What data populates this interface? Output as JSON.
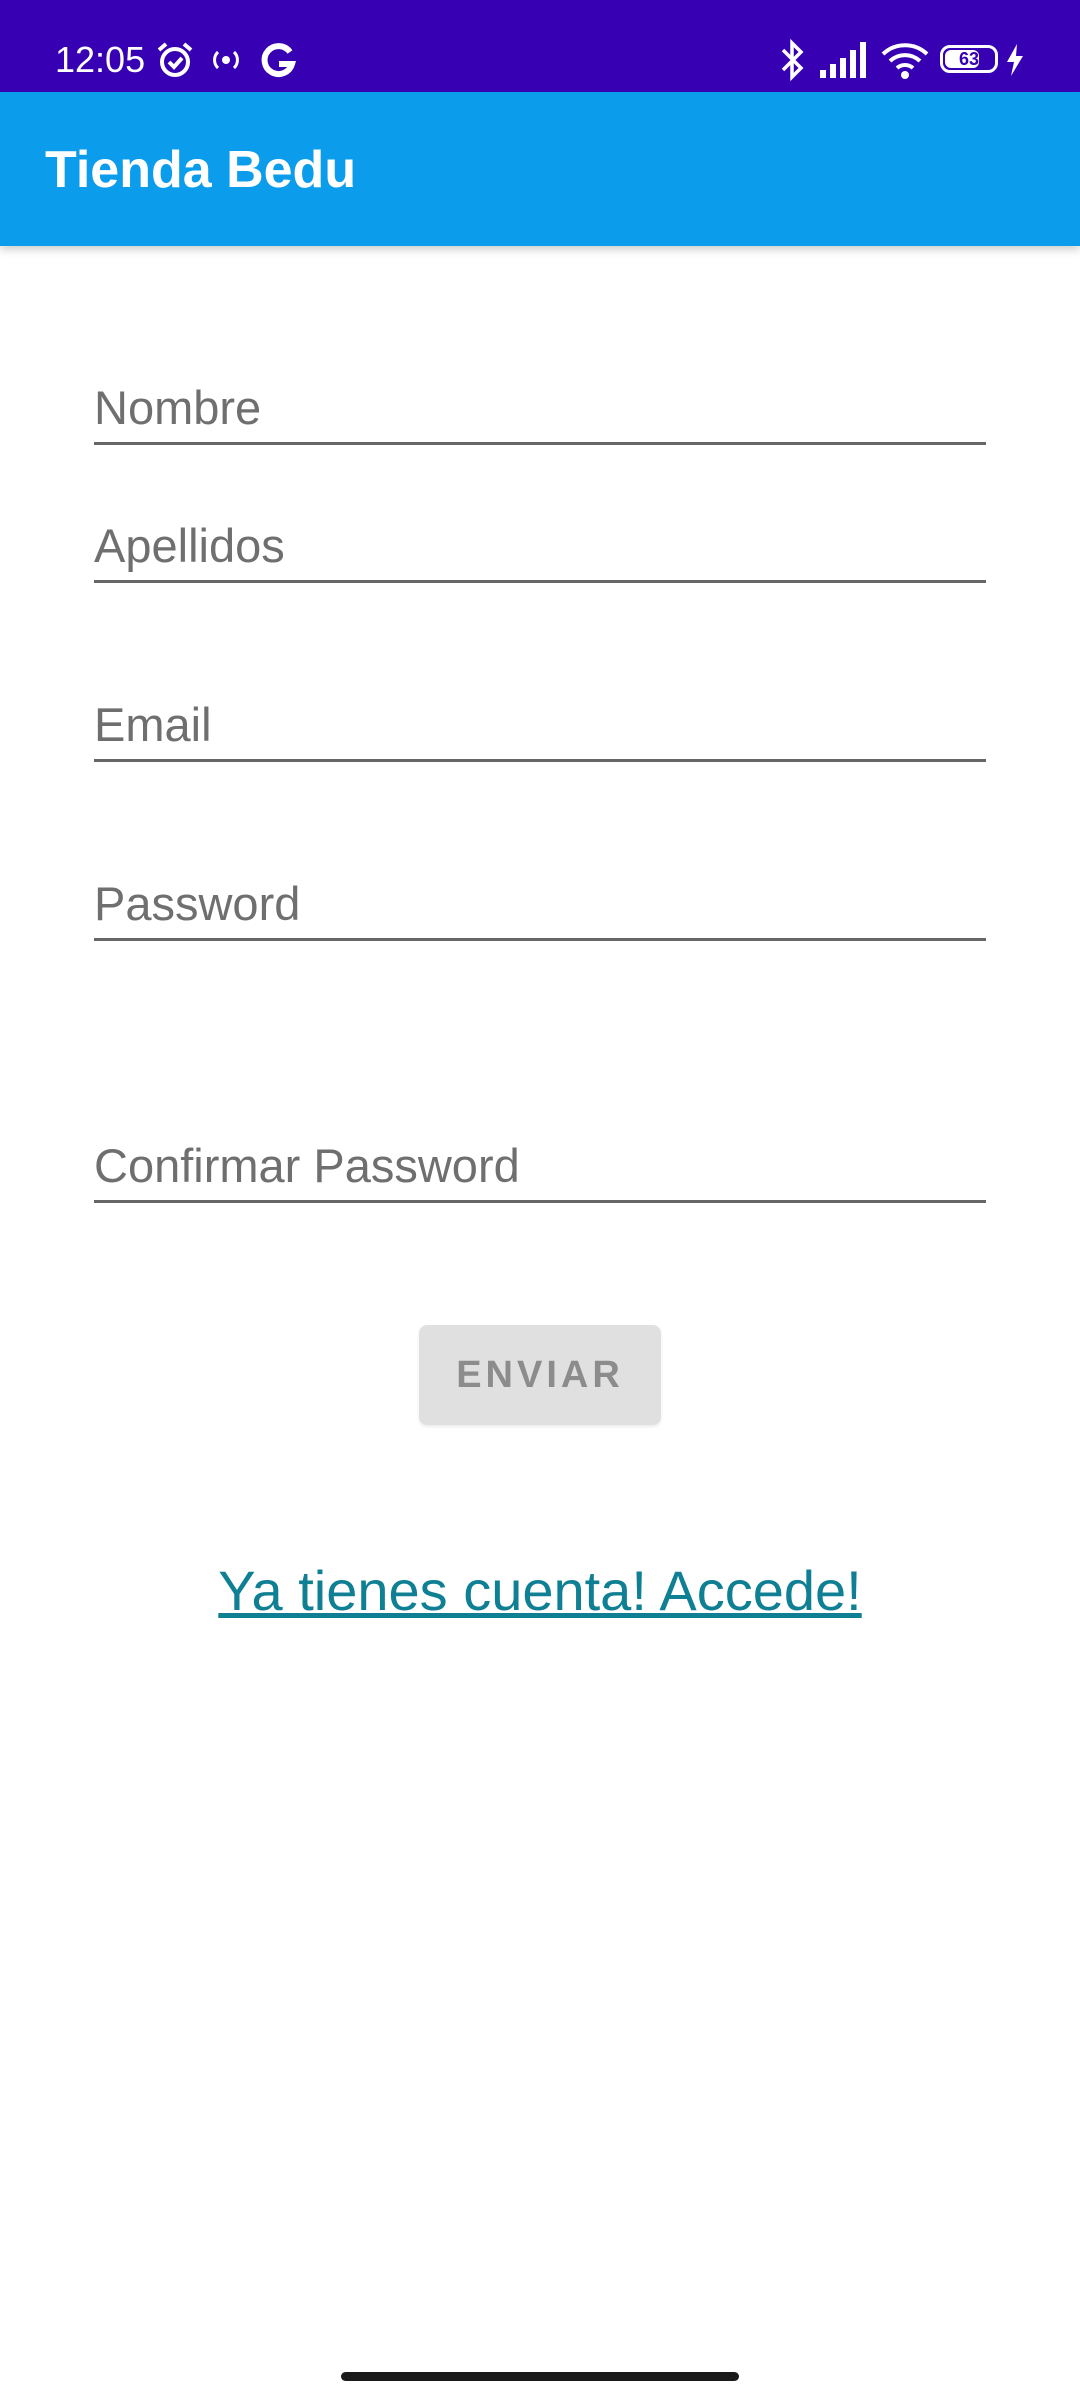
{
  "status_bar": {
    "time": "12:05",
    "battery": "63",
    "icons": [
      "alarm-icon",
      "radio-icon",
      "google-icon",
      "bluetooth-icon",
      "signal-icon",
      "wifi-icon",
      "battery-icon",
      "charging-icon"
    ],
    "background": "#3700b3"
  },
  "app_bar": {
    "title": "Tienda Bedu",
    "background": "#0b9deb"
  },
  "form": {
    "nombre_placeholder": "Nombre",
    "apellidos_placeholder": "Apellidos",
    "email_placeholder": "Email",
    "password_placeholder": "Password",
    "confirm_password_placeholder": "Confirmar Password",
    "submit_label": "ENVIAR"
  },
  "login_link": {
    "text": "Ya tienes cuenta! Accede!",
    "color": "#0f7f94"
  }
}
